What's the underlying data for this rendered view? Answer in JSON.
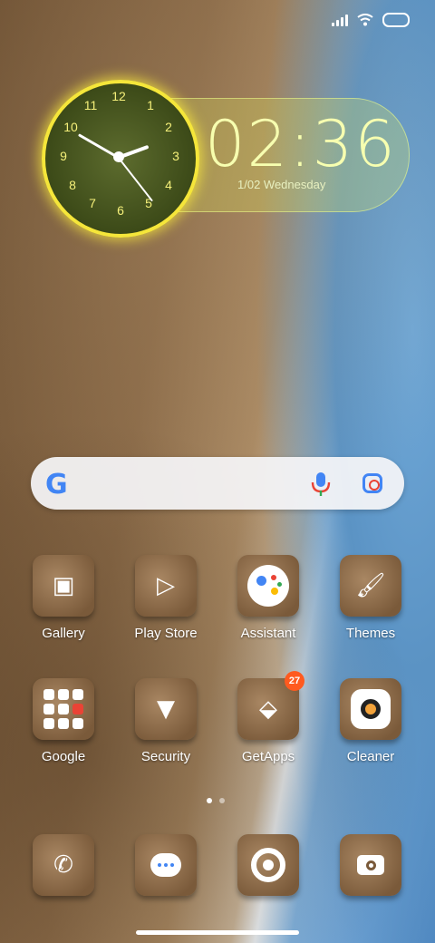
{
  "status_bar": {
    "icons": [
      "signal-icon",
      "wifi-icon",
      "battery-icon"
    ]
  },
  "clock": {
    "time": "02:36",
    "date": "1/02 Wednesday",
    "dial_numbers": [
      "12",
      "1",
      "2",
      "3",
      "4",
      "5",
      "6",
      "7",
      "8",
      "9",
      "10",
      "11"
    ]
  },
  "search": {
    "logo": "G"
  },
  "apps": [
    {
      "label": "Gallery",
      "icon": "gallery-icon"
    },
    {
      "label": "Play Store",
      "icon": "play-store-icon"
    },
    {
      "label": "Assistant",
      "icon": "assistant-icon"
    },
    {
      "label": "Themes",
      "icon": "brush-icon"
    },
    {
      "label": "Google",
      "icon": "google-folder-icon"
    },
    {
      "label": "Security",
      "icon": "security-icon"
    },
    {
      "label": "GetApps",
      "icon": "getapps-icon",
      "badge": "27"
    },
    {
      "label": "Cleaner",
      "icon": "cleaner-icon"
    }
  ],
  "dock": [
    {
      "icon": "phone-icon"
    },
    {
      "icon": "messages-icon"
    },
    {
      "icon": "chrome-icon"
    },
    {
      "icon": "camera-icon"
    }
  ],
  "pager": {
    "pages": 2,
    "active": 1
  },
  "colors": {
    "accent_clock": "#f5e63a",
    "badge": "#ff5a1f"
  }
}
